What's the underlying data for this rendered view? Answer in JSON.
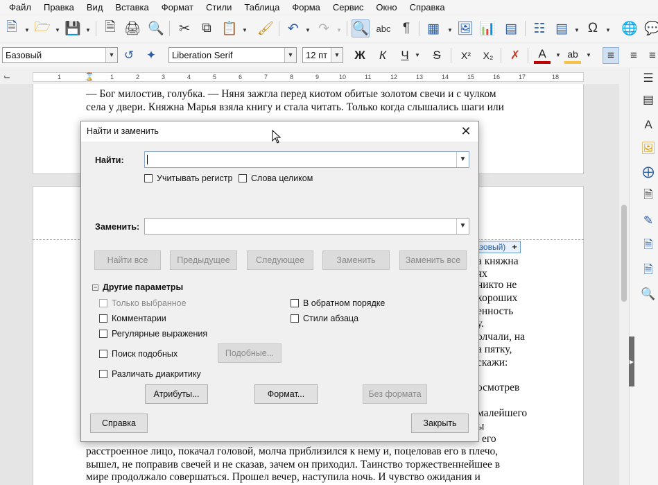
{
  "menu": [
    "Файл",
    "Правка",
    "Вид",
    "Вставка",
    "Формат",
    "Стили",
    "Таблица",
    "Форма",
    "Сервис",
    "Окно",
    "Справка"
  ],
  "formatting": {
    "paragraph_style": "Базовый",
    "font_name": "Liberation Serif",
    "font_size": "12 пт",
    "bold": "Ж",
    "italic": "К",
    "underline": "Ч",
    "strike": "S",
    "superscript": "X²",
    "subscript": "X₂"
  },
  "ruler": {
    "ticks": [
      "1",
      "1",
      "2",
      "3",
      "4",
      "5",
      "6",
      "7",
      "8",
      "9",
      "10",
      "11",
      "12",
      "13",
      "14",
      "15",
      "16",
      "17",
      "18"
    ]
  },
  "document": {
    "page1_lines": [
      "— Бог милостив, голубка. — Няня зажгла перед киотом обитые золотом свечи и с чулком",
      "села у двери. Княжна Марья взяла книгу и стала читать. Только когда слышались шаги или"
    ],
    "header_tag": "азовый)",
    "right_fragments": [
      "а княжна",
      "ях",
      "никто не",
      "хороших",
      "енность",
      "у.",
      "олчали, на",
      "а пятку,",
      "скажи:",
      "осмотрев",
      "малейшего",
      "ы"
    ],
    "bottom_lines": [
      "его",
      "расстроенное лицо, покачал головой, молча приблизился к нему и, поцеловав его в плечо,",
      "вышел, не поправив свечей и не сказав, зачем он приходил. Таинство торжественнейшее в",
      "мире продолжало совершаться. Прошел вечер, наступила ночь. И чувство ожидания и"
    ]
  },
  "dialog": {
    "title": "Найти и заменить",
    "find_label": "Найти:",
    "find_value": "",
    "match_case": "Учитывать регистр",
    "whole_words": "Слова целиком",
    "replace_label": "Заменить:",
    "replace_value": "",
    "buttons": {
      "find_all": "Найти все",
      "previous": "Предыдущее",
      "next": "Следующее",
      "replace": "Заменить",
      "replace_all": "Заменить все"
    },
    "other_options": "Другие параметры",
    "options": {
      "current_selection": "Только выбранное",
      "backwards": "В обратном порядке",
      "comments": "Комментарии",
      "paragraph_styles": "Стили абзаца",
      "regex": "Регулярные выражения",
      "similarity": "Поиск подобных",
      "similarity_btn": "Подобные...",
      "diacritics": "Различать диакритику"
    },
    "attributes_btn": "Атрибуты...",
    "format_btn": "Формат...",
    "no_format_btn": "Без формата",
    "help_btn": "Справка",
    "close_btn": "Закрыть"
  },
  "colors": {
    "accent": "#2b5ea7",
    "font_color": "#c00000",
    "highlight": "#f5c243"
  }
}
